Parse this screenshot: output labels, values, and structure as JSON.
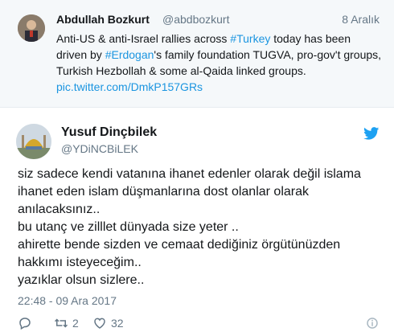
{
  "quoted_tweet": {
    "author_name": "Abdullah Bozkurt",
    "author_handle": "@abdbozkurt",
    "date": "8 Aralık",
    "text_parts": {
      "p1": "Anti-US & anti-Israel rallies across ",
      "hashtag1": "#Turkey",
      "p2": " today has been driven by ",
      "hashtag2": "#Erdogan",
      "p3": "'s family foundation TUGVA, pro-gov't groups, Turkish Hezbollah & some al-Qaida linked groups.",
      "link": "pic.twitter.com/DmkP157GRs"
    },
    "avatar_icon": "profile-photo"
  },
  "tweet": {
    "author_name": "Yusuf Dinçbilek",
    "author_handle": "@YDiNCBiLEK",
    "text": "siz sadece kendi vatanına ihanet edenler olarak değil islama ihanet eden islam düşmanlarına dost olanlar olarak anılacaksınız..\nbu utanç ve zilllet dünyada size yeter ..\nahirette bende sizden ve cemaat dediğiniz örgütünüzden hakkımı isteyeceğim..\nyazıklar olsun sizlere..",
    "timestamp": "22:48 - 09 Ara 2017",
    "actions": {
      "reply_count": "",
      "retweet_count": "2",
      "like_count": "32"
    },
    "avatar_icon": "mosque-profile-photo",
    "bird_icon": "twitter-bird-icon"
  },
  "colors": {
    "link": "#1b95e0",
    "muted": "#657786",
    "twitter_blue": "#1da1f2",
    "quoted_bg": "#f5f8fa"
  }
}
